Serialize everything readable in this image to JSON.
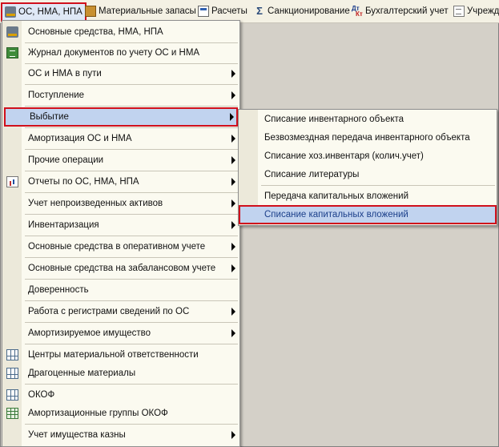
{
  "menubar": {
    "items": [
      {
        "label": "ОС, НМА, НПА",
        "icon": "truck-icon"
      },
      {
        "label": "Материальные запасы",
        "icon": "boxes-icon"
      },
      {
        "label": "Расчеты",
        "icon": "calculation-icon"
      },
      {
        "label": "Санкционирование",
        "icon": "sigma-icon"
      },
      {
        "label": "Бухгалтерский учет",
        "icon": "debit-credit-icon",
        "icon_text_top": "Дт",
        "icon_text_bottom": "Кт"
      },
      {
        "label": "Учрежд",
        "icon": "document-icon"
      }
    ]
  },
  "menu": {
    "items": [
      {
        "label": "Основные средства, НМА, НПА",
        "icon": "truck-icon"
      },
      {
        "label": "Журнал документов по учету ОС и НМА",
        "icon": "journal-icon"
      },
      {
        "label": "ОС и НМА в пути"
      },
      {
        "label": "Поступление"
      },
      {
        "label": "Выбытие"
      },
      {
        "label": "Амортизация ОС и НМА"
      },
      {
        "label": "Прочие операции"
      },
      {
        "label": "Отчеты по ОС, НМА, НПА",
        "icon": "report-icon"
      },
      {
        "label": "Учет непроизведенных активов"
      },
      {
        "label": "Инвентаризация"
      },
      {
        "label": "Основные средства в оперативном учете"
      },
      {
        "label": "Основные средства на забалансовом учете"
      },
      {
        "label": "Доверенность"
      },
      {
        "label": "Работа с регистрами сведений по ОС"
      },
      {
        "label": "Амортизируемое имущество"
      },
      {
        "label": "Центры материальной ответственности",
        "icon": "table-icon"
      },
      {
        "label": "Драгоценные материалы",
        "icon": "table-icon"
      },
      {
        "label": "ОКОФ",
        "icon": "table-icon"
      },
      {
        "label": "Амортизационные группы ОКОФ",
        "icon": "table-green-icon"
      },
      {
        "label": "Учет имущества казны"
      }
    ]
  },
  "submenu": {
    "items": [
      {
        "label": "Списание инвентарного объекта"
      },
      {
        "label": "Безвозмездная передача инвентарного объекта"
      },
      {
        "label": "Списание хоз.инвентаря (колич.учет)"
      },
      {
        "label": "Списание литературы"
      },
      {
        "label": "Передача капитальных вложений"
      },
      {
        "label": "Списание капитальных вложений"
      }
    ]
  },
  "colors": {
    "highlight_border": "#d0101c",
    "highlight_fill": "#c1d3ef",
    "menu_bg": "#fbfaf0"
  }
}
